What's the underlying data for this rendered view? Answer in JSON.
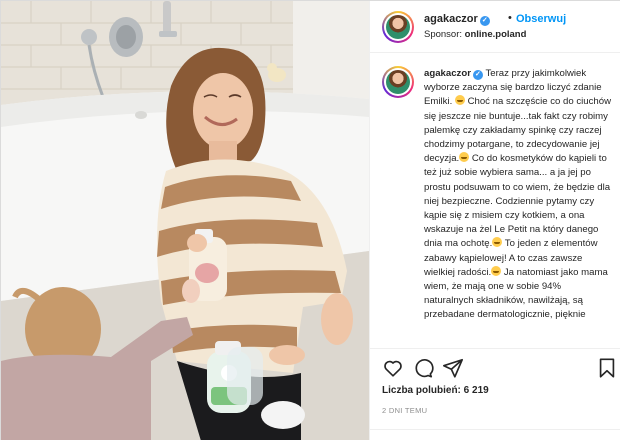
{
  "post": {
    "username": "agakaczor",
    "verified_mark": "✓",
    "follow_label": "Obserwuj",
    "separator": "•",
    "sponsor_prefix": "Sponsor:",
    "sponsor_name": "online.poland",
    "caption_segments": [
      "Teraz przy jakimkolwiek wyborze zaczyna się bardzo liczyć zdanie Emilki. ",
      " Choć na szczęście co do ciuchów się jeszcze nie buntuje...tak fakt czy robimy palemkę czy zakładamy spinkę czy raczej chodzimy potargane, to zdecydowanie jej decyzja.",
      " Co do kosmetyków do kąpieli to też już sobie wybiera sama... a ja jej po prostu podsuwam to co wiem, że będzie dla niej bezpieczne. Codziennie pytamy czy kąpie się z misiem czy kotkiem, a ona wskazuje na żel Le Petit na który danego dnia ma ochotę.",
      " To jeden z elementów zabawy kąpielowej! A to czas zawsze wielkiej radości.",
      " Ja natomiast jako mama wiem, że mają one w sobie 94% naturalnych składników, nawilżają, są przebadane dermatologicznie, pięknie"
    ],
    "likes_label": "Liczba polubień: 6 219",
    "timestamp": "2 DNI TEMU"
  },
  "icons": {
    "like": "heart-icon",
    "comment": "comment-icon",
    "share": "share-icon",
    "save": "bookmark-icon",
    "verified": "verified-badge-icon"
  },
  "colors": {
    "follow": "#0095f6",
    "verified": "#3897f0",
    "text": "#262626",
    "muted": "#8e8e8e"
  }
}
